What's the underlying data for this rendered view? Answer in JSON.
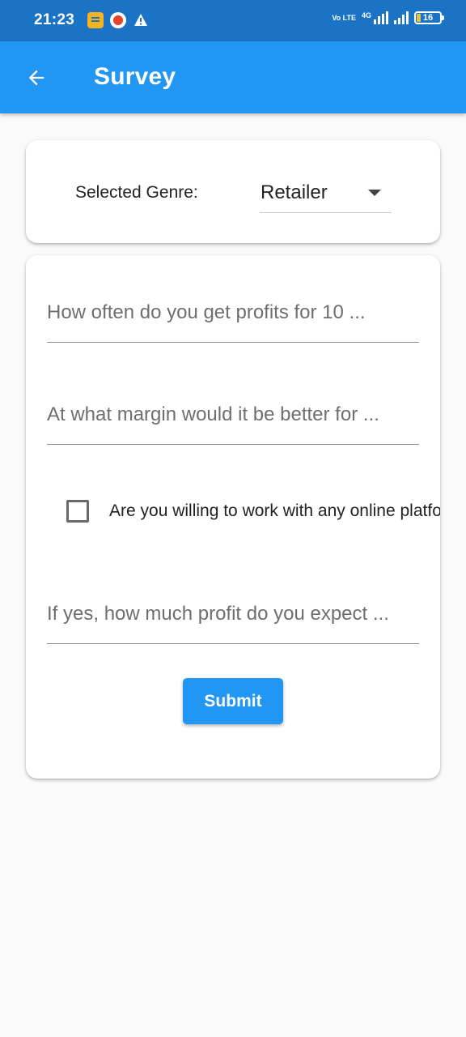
{
  "status_bar": {
    "time": "21:23",
    "network_type": "4G",
    "volte_label": "Vo LTE",
    "battery_level": "16",
    "icons": [
      "note-icon",
      "shopping-bag-icon",
      "warning-icon",
      "volte-icon",
      "signal-4g-icon",
      "signal-icon",
      "battery-icon"
    ]
  },
  "app_bar": {
    "title": "Survey",
    "back_icon": "arrow-back-icon"
  },
  "genre": {
    "label": "Selected Genre:",
    "selected_value": "Retailer"
  },
  "survey": {
    "question_1_placeholder": "How often do you get profits for 10 ...",
    "question_2_placeholder": "At what margin would it be better for ...",
    "checkbox_label": "Are you willing to work with any online platform?",
    "checkbox_checked": false,
    "question_3_placeholder": "If yes, how much profit do you expect ...",
    "submit_label": "Submit"
  },
  "colors": {
    "primary": "#2196f3",
    "status_bar": "#1a73c4",
    "background": "#fafafa"
  }
}
